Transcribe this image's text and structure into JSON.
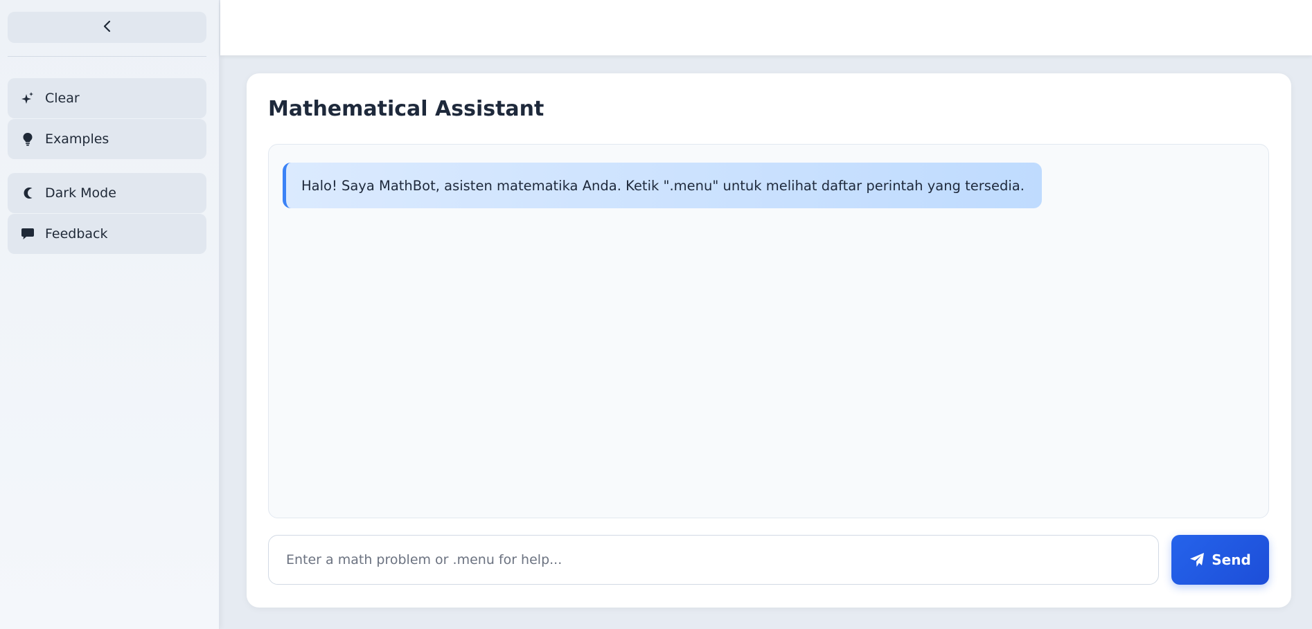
{
  "sidebar": {
    "collapse_icon": "chevron-left-icon",
    "items": [
      {
        "label": "Clear",
        "icon": "sparkles-icon"
      },
      {
        "label": "Examples",
        "icon": "lightbulb-icon"
      },
      {
        "label": "Dark Mode",
        "icon": "moon-icon"
      },
      {
        "label": "Feedback",
        "icon": "comment-icon"
      }
    ]
  },
  "main": {
    "title": "Mathematical Assistant",
    "messages": [
      {
        "sender": "bot",
        "text": "Halo! Saya MathBot, asisten matematika Anda. Ketik \".menu\" untuk melihat daftar perintah yang tersedia."
      }
    ],
    "input": {
      "value": "",
      "placeholder": "Enter a math problem or .menu for help..."
    },
    "send_label": "Send",
    "send_icon": "paper-plane-icon"
  },
  "colors": {
    "accent": "#2563eb",
    "message_border": "#3b82f6",
    "message_bg": "#dbeafe"
  }
}
